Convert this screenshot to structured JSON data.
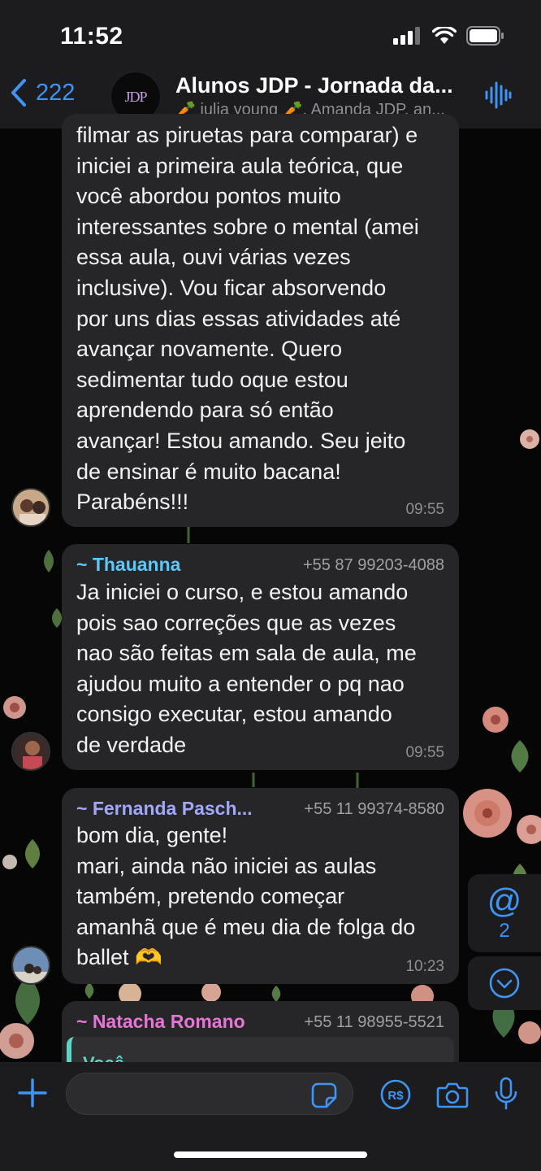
{
  "status_bar": {
    "time": "11:52"
  },
  "header": {
    "back_count": "222",
    "group_avatar_text": "JDP",
    "title": "Alunos JDP - Jornada da...",
    "members": "🥕 julia young 🥕, Amanda JDP, an..."
  },
  "messages": [
    {
      "text": "filmar as piruetas para comparar) e\niniciei a primeira aula teórica, que\nvocê abordou pontos muito\ninteressantes sobre o mental (amei\nessa aula, ouvi várias vezes\ninclusive). Vou ficar absorvendo\npor uns dias essas atividades até\navançar novamente. Quero\nsedimentar tudo oque estou\naprendendo para só então\navançar! Estou amando. Seu jeito\nde ensinar é muito bacana!\nParabéns!!!",
      "time": "09:55"
    },
    {
      "sender": "~ Thauanna",
      "phone": "+55 87 99203-4088",
      "text": "Ja iniciei o curso, e estou amando\npois sao correções que as vezes\nnao são feitas em sala de aula, me\najudou muito a entender o pq nao\nconsigo executar, estou amando\nde verdade",
      "time": "09:55"
    },
    {
      "sender": "~ Fernanda Pasch...",
      "phone": "+55 11 99374-8580",
      "text": "bom dia, gente!\nmari, ainda não iniciei as aulas\ntambém, pretendo começar\namanhã que é meu dia de folga do\nballet 🫶",
      "time": "10:23"
    },
    {
      "sender": "~ Natacha Romano",
      "phone": "+55 11 98955-5521",
      "quote_author": "Você"
    }
  ],
  "mentions": {
    "symbol": "@",
    "count": "2"
  },
  "input": {
    "placeholder": "",
    "value": ""
  },
  "colors": {
    "accent": "#3e95f5",
    "bubble": "#262628",
    "bar": "#1c1c1e",
    "sender_thauanna": "#5ac8fa",
    "sender_fernanda": "#a2a8f7",
    "sender_natacha": "#e974d8",
    "quote_accent": "#5fd4c3"
  }
}
